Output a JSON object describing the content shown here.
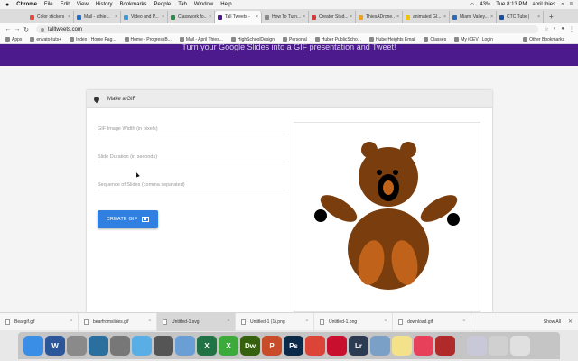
{
  "menubar": {
    "app": "Chrome",
    "items": [
      "File",
      "Edit",
      "View",
      "History",
      "Bookmarks",
      "People",
      "Tab",
      "Window",
      "Help"
    ],
    "battery": "43%",
    "clock": "Tue 8:13 PM",
    "user": "april.thies"
  },
  "tabs": [
    {
      "label": "Color stickers",
      "color": "#e84b3c"
    },
    {
      "label": "Mail - athie...",
      "color": "#1f6fd1"
    },
    {
      "label": "Video and P...",
      "color": "#3a9bd8"
    },
    {
      "label": "Classwork fo...",
      "color": "#2c8a4b"
    },
    {
      "label": "Tall Tweets -",
      "color": "#4c1a8c",
      "active": true
    },
    {
      "label": "How To Turn...",
      "color": "#888888"
    },
    {
      "label": "Creator Stud...",
      "color": "#d13c3c"
    },
    {
      "label": "ThiesADrone...",
      "color": "#f0a020"
    },
    {
      "label": "animated GI...",
      "color": "#f2c200"
    },
    {
      "label": "Miami Valley...",
      "color": "#2a6cb8"
    },
    {
      "label": "CTC Tube |",
      "color": "#1b4fa0"
    }
  ],
  "address": {
    "url": "talltweets.com"
  },
  "bookmarks": {
    "items": [
      "Apps",
      "envato-tuts+",
      "Index - Home Pag...",
      "Home - ProgressB...",
      "Mail - April Thies...",
      "HighSchoolDesign",
      "Personal",
      "Huber PublicScho...",
      "HuberHeights Email",
      "Classes",
      "My iCEV | Login"
    ],
    "other": "Other Bookmarks"
  },
  "banner": {
    "text": "Turn your Google Slides into a GIF presentation and Tweet!"
  },
  "card": {
    "title": "Make a GIF",
    "width_placeholder": "GIF Image Width (in pixels)",
    "duration_placeholder": "Slide Duration (in seconds)",
    "sequence_placeholder": "Sequence of Slides (comma separated)",
    "create_label": "CREATE GIF"
  },
  "downloads": {
    "items": [
      "Beargif.gif",
      "bearfromslides.gif",
      "Untitled-1.svg",
      "Untitled-1 (1).png",
      "Untitled-1.png",
      "download.gif"
    ],
    "show_all": "Show All"
  },
  "dock": [
    {
      "name": "finder-icon",
      "color": "#3a8ee6",
      "glyph": ""
    },
    {
      "name": "word-icon",
      "color": "#2b579a",
      "glyph": "W"
    },
    {
      "name": "launchpad-icon",
      "color": "#8a8a8a",
      "glyph": ""
    },
    {
      "name": "quicktime-icon",
      "color": "#2a6f9e",
      "glyph": ""
    },
    {
      "name": "system-preferences-icon",
      "color": "#777777",
      "glyph": ""
    },
    {
      "name": "app-store-icon",
      "color": "#5aaee6",
      "glyph": ""
    },
    {
      "name": "screenshot-icon",
      "color": "#555555",
      "glyph": ""
    },
    {
      "name": "preview-icon",
      "color": "#6a9fd6",
      "glyph": ""
    },
    {
      "name": "excel-icon",
      "color": "#217346",
      "glyph": "X"
    },
    {
      "name": "sketch-icon",
      "color": "#3cab3c",
      "glyph": "X"
    },
    {
      "name": "dreamweaver-icon",
      "color": "#35600e",
      "glyph": "Dw"
    },
    {
      "name": "powerpoint-icon",
      "color": "#c84b2a",
      "glyph": "P"
    },
    {
      "name": "photoshop-icon",
      "color": "#0b2a4a",
      "glyph": "Ps"
    },
    {
      "name": "chrome-icon",
      "color": "#db4437",
      "glyph": ""
    },
    {
      "name": "acrobat-icon",
      "color": "#c8102e",
      "glyph": ""
    },
    {
      "name": "lightroom-icon",
      "color": "#2c3a52",
      "glyph": "Lr"
    },
    {
      "name": "image-capture-icon",
      "color": "#7aa0c8",
      "glyph": ""
    },
    {
      "name": "notes-icon",
      "color": "#f4e28a",
      "glyph": ""
    },
    {
      "name": "creative-cloud-icon",
      "color": "#e6405a",
      "glyph": ""
    },
    {
      "name": "photo-booth-icon",
      "color": "#b02a2a",
      "glyph": ""
    },
    {
      "name": "downloads-stack-icon",
      "color": "#c8c8d8",
      "glyph": ""
    },
    {
      "name": "documents-stack-icon",
      "color": "#d0d0d0",
      "glyph": ""
    },
    {
      "name": "trash-icon",
      "color": "#e0e0e0",
      "glyph": ""
    }
  ]
}
